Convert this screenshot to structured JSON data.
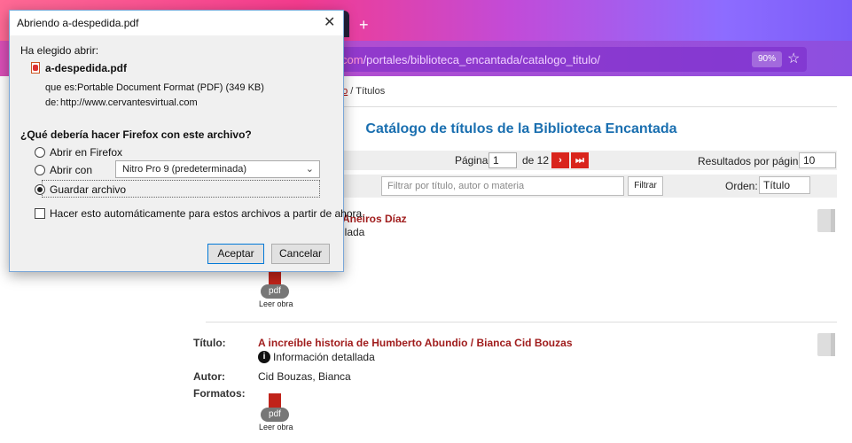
{
  "browser": {
    "new_tab_glyph": "+",
    "url_host": "com",
    "url_path": "/portales/biblioteca_encantada/catalogo_titulo/",
    "zoom": "90%",
    "star_glyph": "☆"
  },
  "page": {
    "breadcrumb_link": "go",
    "breadcrumb_sep": " / ",
    "breadcrumb_current": "Títulos",
    "title": "Catálogo de títulos de la Biblioteca Encantada",
    "pager": {
      "pagina_label": "Página:",
      "current_page": "1",
      "of_pages": "de 12",
      "next_glyph": "›",
      "last_glyph": "⏭",
      "rpp_label": "Resultados por página:",
      "rpp_value": "10"
    },
    "filter": {
      "placeholder": "Filtrar por título, autor o materia",
      "button": "Filtrar",
      "orden_label": "Orden:",
      "orden_value": "Título"
    },
    "results": [
      {
        "title_fragment": "Aneiros Díaz",
        "info_fragment": "llada",
        "pdf_label": "pdf",
        "read_label": "Leer obra"
      },
      {
        "titulo_label": "Título:",
        "title": "A increíble historia de Humberto Abundio / Bianca Cid Bouzas",
        "info_glyph": "i",
        "info_label": "Información detallada",
        "autor_label": "Autor:",
        "author": "Cid Bouzas, Bianca",
        "formatos_label": "Formatos:",
        "pdf_label": "pdf",
        "read_label": "Leer obra"
      }
    ]
  },
  "dialog": {
    "title": "Abriendo a-despedida.pdf",
    "close_glyph": "✕",
    "chosen_label": "Ha elegido abrir:",
    "filename": "a-despedida.pdf",
    "type_label": "que es:",
    "type_value": "Portable Document Format (PDF) (349 KB)",
    "from_label": "de:",
    "from_value": "http://www.cervantesvirtual.com",
    "question": "¿Qué debería hacer Firefox con este archivo?",
    "option_open_firefox": "Abrir en Firefox",
    "option_open_with": "Abrir con",
    "app_select_value": "Nitro Pro 9 (predeterminada)",
    "option_save": "Guardar archivo",
    "selected_option": "save",
    "auto_checkbox": "Hacer esto automáticamente para estos archivos a partir de ahora.",
    "accept_button": "Aceptar",
    "cancel_button": "Cancelar"
  }
}
